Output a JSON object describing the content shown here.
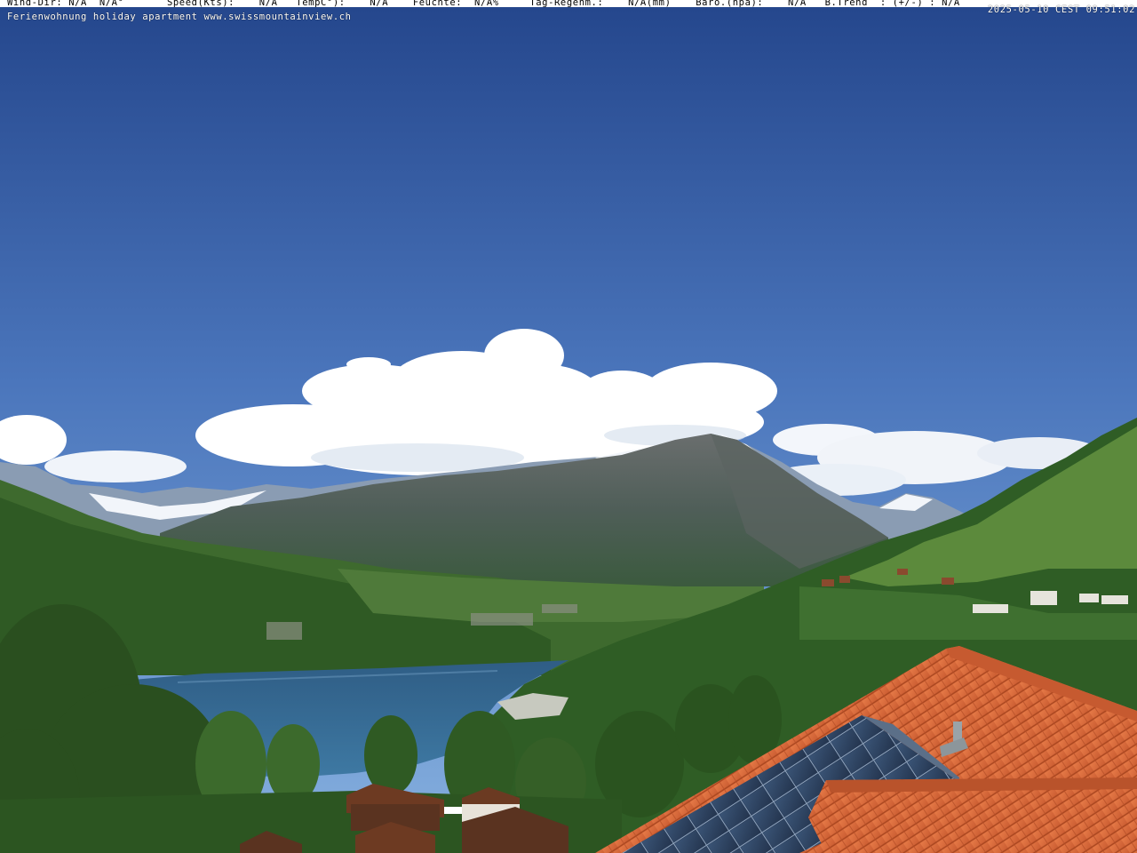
{
  "overlay": {
    "weather_line": "Wind-Dir: N/A  N/A°       Speed(Kts):    N/A   TempC°):    N/A    Feuchte:  N/A%     Tag-Regenm.:    N/A(mm)    Baro.(hpa):    N/A   B.Trend  : (+/-) : N/A",
    "caption": "Ferienwohnung holiday apartment www.swissmountainview.ch",
    "timestamp": "2025-05-10 CEST 09:51:02"
  },
  "colors": {
    "sky_top": "#25488e",
    "sky_bottom": "#7fa9dc",
    "lake": "#3a6c96",
    "roof_tiles": "#d8693c",
    "solar_panel": "#334b6e",
    "forest": "#2e5a22"
  },
  "icons": {
    "scene": "webcam-landscape-photo"
  }
}
